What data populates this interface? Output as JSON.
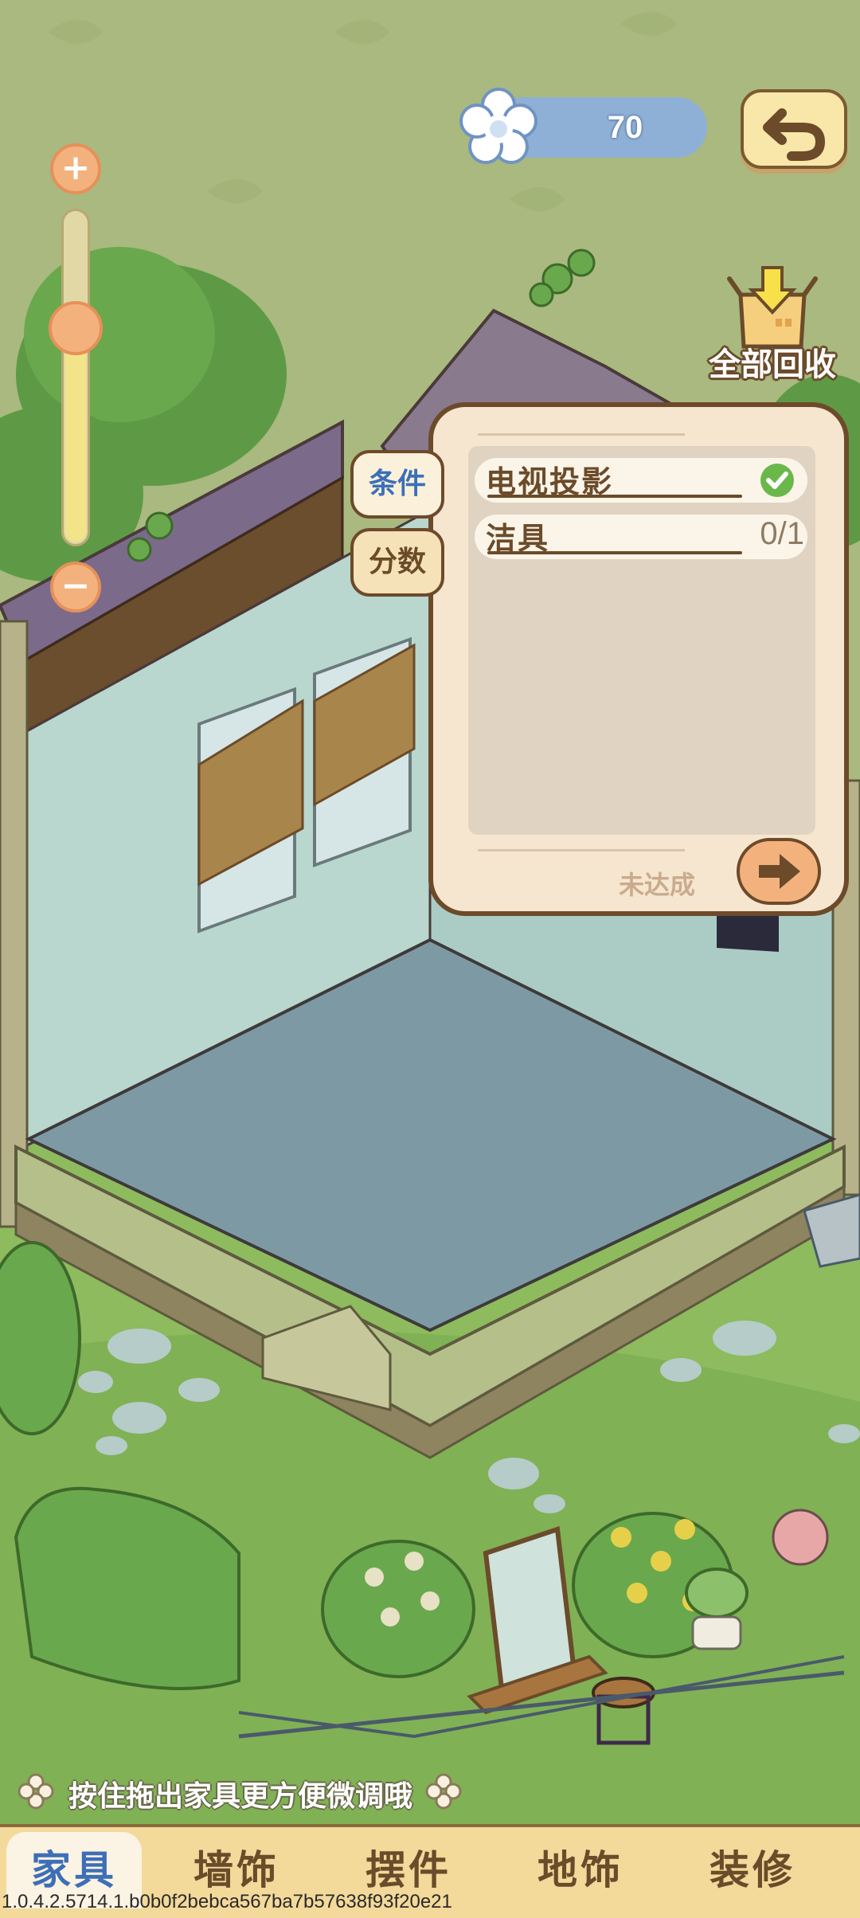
{
  "currency": {
    "value": "70"
  },
  "recycle": {
    "label": "全部回收"
  },
  "panel": {
    "tabs": [
      {
        "label": "条件",
        "active": true
      },
      {
        "label": "分数",
        "active": false
      }
    ],
    "conditions": [
      {
        "label": "电视投影",
        "status": "completed"
      },
      {
        "label": "洁具",
        "progress": "0/1"
      }
    ],
    "status_text": "未达成"
  },
  "hint": {
    "text": "按住拖出家具更方便微调哦"
  },
  "bottom_tabs": [
    {
      "label": "家具",
      "active": true
    },
    {
      "label": "墙饰",
      "active": false
    },
    {
      "label": "摆件",
      "active": false
    },
    {
      "label": "地饰",
      "active": false
    },
    {
      "label": "装修",
      "active": false
    }
  ],
  "version": "1.0.4.2.5714.1.b0b0f2bebca567ba7b57638f93f20e21",
  "colors": {
    "accent_blue": "#3d6fb8",
    "panel_bg": "#f6e6cf",
    "border_brown": "#6d4a2a",
    "check_green": "#6bb84a",
    "orange_button": "#f3b27d"
  }
}
